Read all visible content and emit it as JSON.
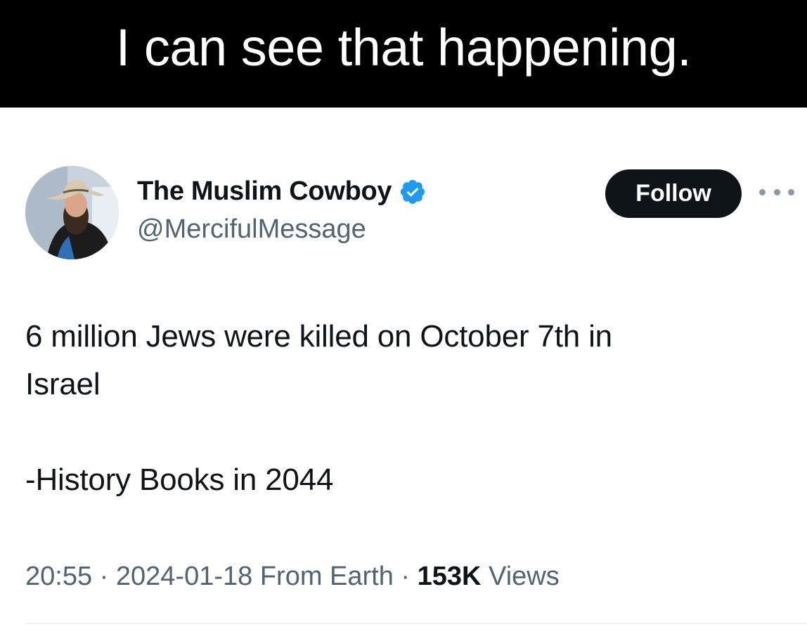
{
  "caption": {
    "text": "I can see that happening."
  },
  "tweet": {
    "author": {
      "display_name": "The Muslim Cowboy",
      "handle": "@MercifulMessage",
      "verified": true,
      "avatar_icon": "profile-photo-man-in-cowboy-hat"
    },
    "follow_label": "Follow",
    "more_icon": "more-options-icon",
    "body": {
      "line1": "6 million Jews were killed on October 7th in",
      "line2": "Israel",
      "line3": "-History Books in 2044"
    },
    "meta": {
      "time": "20:55",
      "sep1": " · ",
      "date": "2024-01-18",
      "source": " From Earth",
      "sep2": " · ",
      "views_count": "153K",
      "views_label": " Views"
    }
  },
  "colors": {
    "caption_bg": "#000000",
    "caption_text": "#ffffff",
    "primary_text": "#0f1419",
    "secondary_text": "#536471",
    "verified_badge": "#1d9bf0",
    "follow_bg": "#0f1419"
  }
}
